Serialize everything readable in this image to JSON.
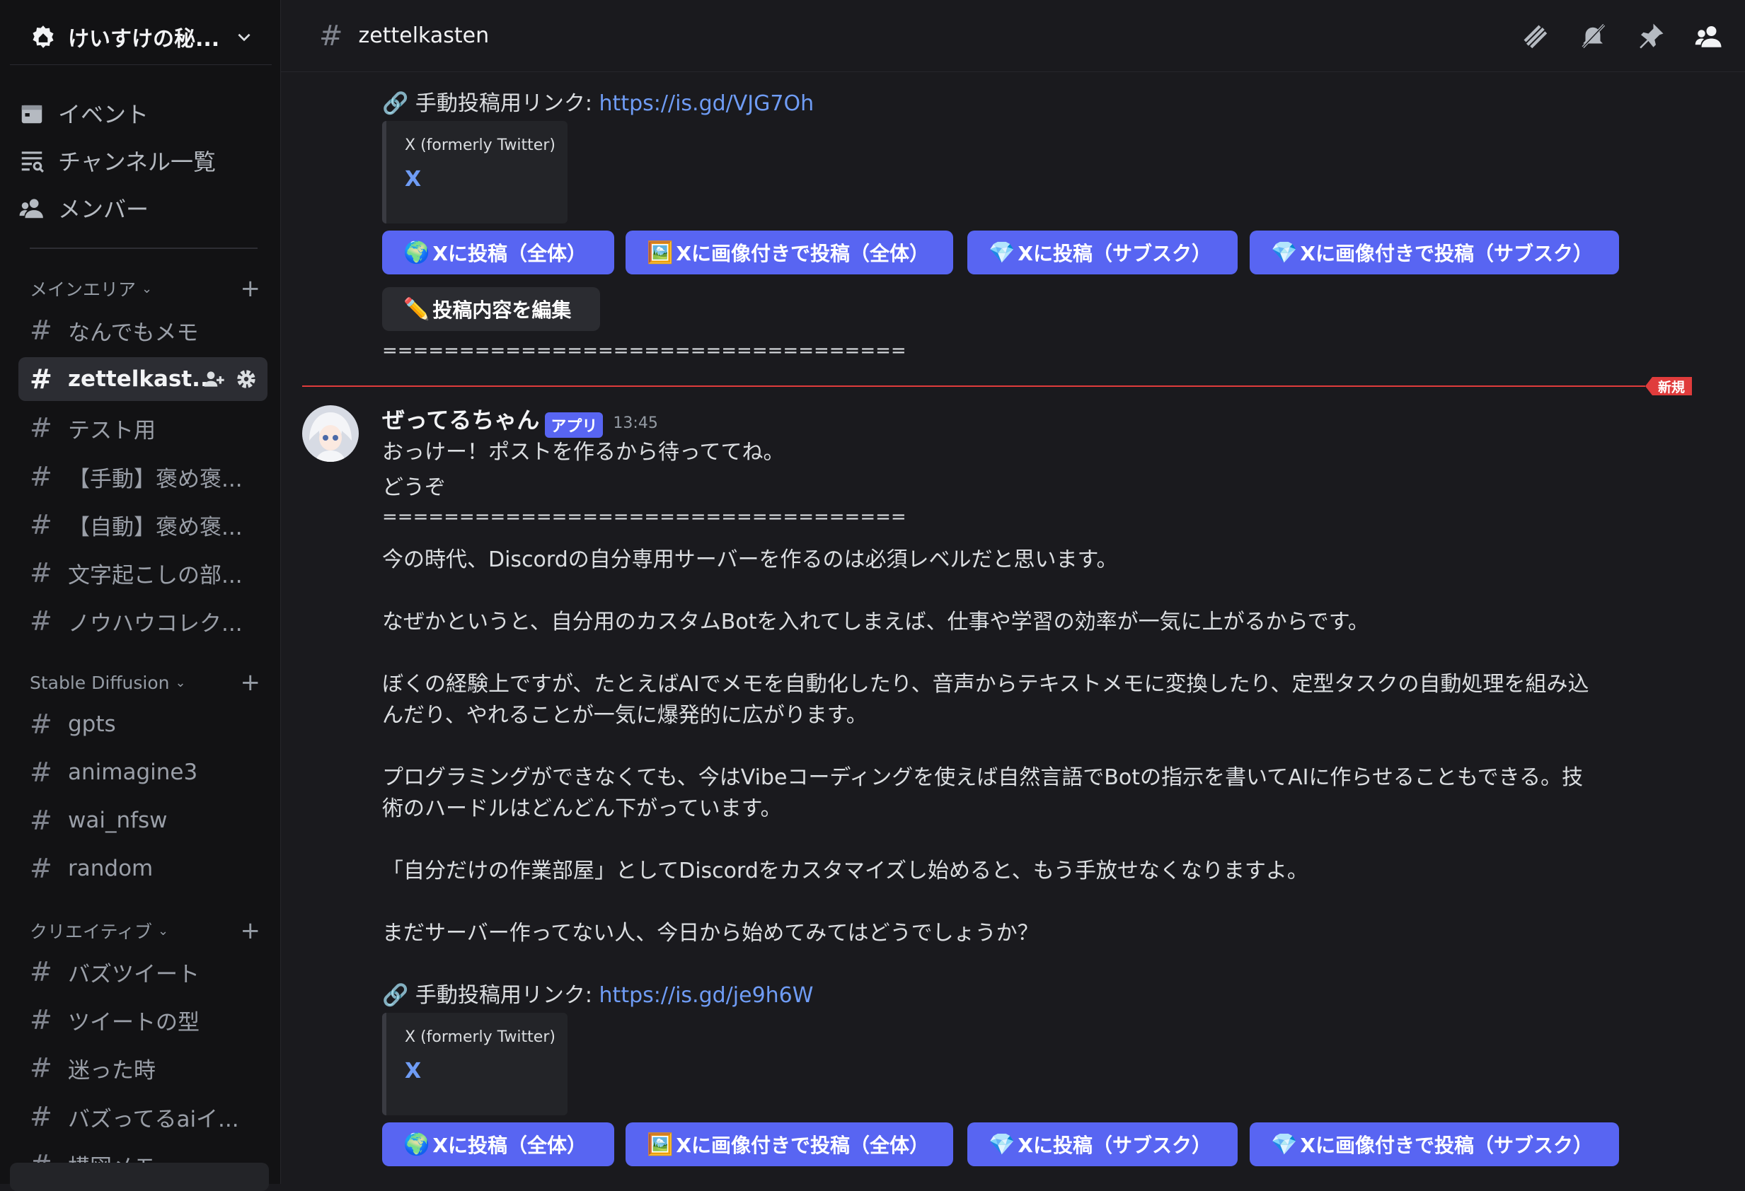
{
  "server": {
    "name": "けいすけの秘..."
  },
  "nav": {
    "events": "イベント",
    "channel_list": "チャンネル一覧",
    "members": "メンバー"
  },
  "categories": [
    {
      "name": "メインエリア"
    },
    {
      "name": "Stable Diffusion"
    },
    {
      "name": "クリエイティブ"
    }
  ],
  "channels": [
    "なんでもメモ",
    "zettelkast...",
    "テスト用",
    "【手動】褒め褒...",
    "【自動】褒め褒...",
    "文字起こしの部...",
    "ノウハウコレク...",
    "gpts",
    "animagine3",
    "wai_nfsw",
    "random",
    "バズツイート",
    "ツイートの型",
    "迷った時",
    "バズってるaiイ...",
    "構図メモ"
  ],
  "topbar": {
    "channel": "zettelkasten"
  },
  "message_prev": {
    "link_label": "🔗 手動投稿用リンク: ",
    "link_url": "https://is.gd/VJG7Oh",
    "embed_provider": "X (formerly Twitter)",
    "embed_title": "X",
    "separator": "=================================="
  },
  "buttons": {
    "post_all": "Xに投稿（全体）",
    "post_image_all": "Xに画像付きで投稿（全体）",
    "post_sub": "Xに投稿（サブスク）",
    "post_image_sub": "Xに画像付きで投稿（サブスク）",
    "edit": "投稿内容を編集"
  },
  "new_badge": "新規",
  "message": {
    "author": "ぜってるちゃん",
    "badge": "アプリ",
    "time": "13:45",
    "line1": "おっけー！ポストを作るから待っててね。",
    "line2": "どうぞ",
    "separator": "==================================",
    "p1": "今の時代、Discordの自分専用サーバーを作るのは必須レベルだと思います。",
    "p2": "なぜかというと、自分用のカスタムBotを入れてしまえば、仕事や学習の効率が一気に上がるからです。",
    "p3a": "ぼくの経験上ですが、たとえばAIでメモを自動化したり、音声からテキストメモに変換したり、定型タスクの自動処理を組み込",
    "p3b": "んだり、やれることが一気に爆発的に広がります。",
    "p4a": "プログラミングができなくても、今はVibeコーディングを使えば自然言語でBotの指示を書いてAIに作らせることもできる。技",
    "p4b": "術のハードルはどんどん下がっています。",
    "p5": "「自分だけの作業部屋」としてDiscordをカスタマイズし始めると、もう手放せなくなりますよ。",
    "p6": "まだサーバー作ってない人、今日から始めてみてはどうでしょうか？",
    "link_label": "🔗 手動投稿用リンク: ",
    "link_url": "https://is.gd/je9h6W",
    "embed_provider": "X (formerly Twitter)",
    "embed_title": "X"
  }
}
